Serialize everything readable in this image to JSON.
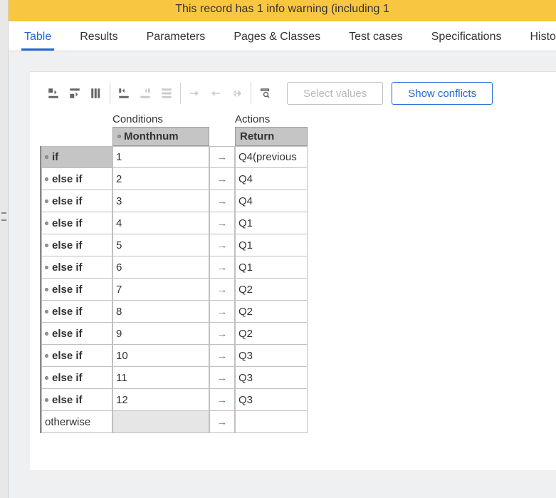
{
  "warning": "This record has 1 info warning (including 1",
  "tabs": [
    "Table",
    "Results",
    "Parameters",
    "Pages & Classes",
    "Test cases",
    "Specifications",
    "Histor"
  ],
  "active_tab": 0,
  "buttons": {
    "select_values": "Select values",
    "show_conflicts": "Show conflicts"
  },
  "section_labels": {
    "conditions": "Conditions",
    "actions": "Actions"
  },
  "column_headers": {
    "condition": "Monthnum",
    "return": "Return"
  },
  "rows": [
    {
      "label": "if",
      "cond": "1",
      "ret": "Q4(previous",
      "hl": true
    },
    {
      "label": "else if",
      "cond": "2",
      "ret": "Q4"
    },
    {
      "label": "else if",
      "cond": "3",
      "ret": "Q4"
    },
    {
      "label": "else if",
      "cond": "4",
      "ret": "Q1"
    },
    {
      "label": "else if",
      "cond": "5",
      "ret": "Q1"
    },
    {
      "label": "else if",
      "cond": "6",
      "ret": "Q1"
    },
    {
      "label": "else if",
      "cond": "7",
      "ret": "Q2"
    },
    {
      "label": "else if",
      "cond": "8",
      "ret": "Q2"
    },
    {
      "label": "else if",
      "cond": "9",
      "ret": "Q2"
    },
    {
      "label": "else if",
      "cond": "10",
      "ret": "Q3"
    },
    {
      "label": "else if",
      "cond": "11",
      "ret": "Q3"
    },
    {
      "label": "else if",
      "cond": "12",
      "ret": "Q3"
    },
    {
      "label": "otherwise",
      "cond": "",
      "ret": "",
      "ow": true
    }
  ]
}
